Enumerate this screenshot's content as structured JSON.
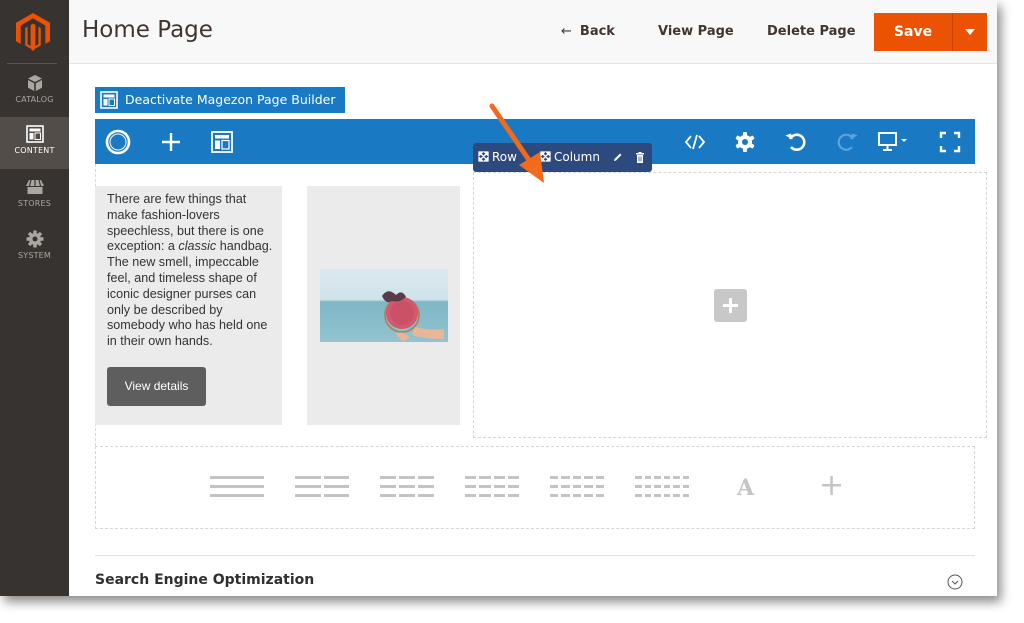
{
  "sidebar": {
    "logo": "magento-logo",
    "items": [
      {
        "label": "CATALOG",
        "icon": "cube-icon",
        "active": false
      },
      {
        "label": "CONTENT",
        "icon": "layout-icon",
        "active": true
      },
      {
        "label": "STORES",
        "icon": "storefront-icon",
        "active": false
      },
      {
        "label": "SYSTEM",
        "icon": "gear-icon",
        "active": false
      }
    ]
  },
  "header": {
    "title": "Home Page",
    "back_arrow": "←",
    "back_label": "Back",
    "view_label": "View Page",
    "delete_label": "Delete Page",
    "save_label": "Save",
    "save_color": "#eb5202"
  },
  "builder": {
    "deactivate_label": "Deactivate Magezon Page Builder",
    "accent_color": "#1979c3",
    "toolbar_left": [
      "magezon-logo-icon",
      "add-element-icon",
      "templates-icon"
    ],
    "toolbar_right": [
      "code-icon",
      "settings-icon",
      "undo-icon",
      "redo-icon",
      "device-preview-icon",
      "fullscreen-icon"
    ],
    "controls": {
      "row_label": "Row",
      "column_label": "Column",
      "edit_icon": "pencil-icon",
      "delete_icon": "trash-icon"
    },
    "column1": {
      "text_before": "There are few things that make fashion-lovers speechless, but there is one exception: a ",
      "text_italic": "classic",
      "text_after": " handbag. The new smell, impeccable feel, and timeless shape of iconic designer purses can only be described by somebody who has held one in their own hands.",
      "button_label": "View details"
    },
    "column2": {
      "image": "handbag-beach-photo"
    },
    "column3": {
      "add_icon": "plus-icon"
    },
    "layouts": [
      {
        "name": "1-column",
        "cols": 1
      },
      {
        "name": "2-columns",
        "cols": 2
      },
      {
        "name": "3-columns",
        "cols": 3
      },
      {
        "name": "4-columns",
        "cols": 4
      },
      {
        "name": "5-columns",
        "cols": 5
      },
      {
        "name": "6-columns",
        "cols": 6
      }
    ],
    "text_block_glyph": "A",
    "add_row_glyph": "+"
  },
  "seo": {
    "title": "Search Engine Optimization"
  }
}
